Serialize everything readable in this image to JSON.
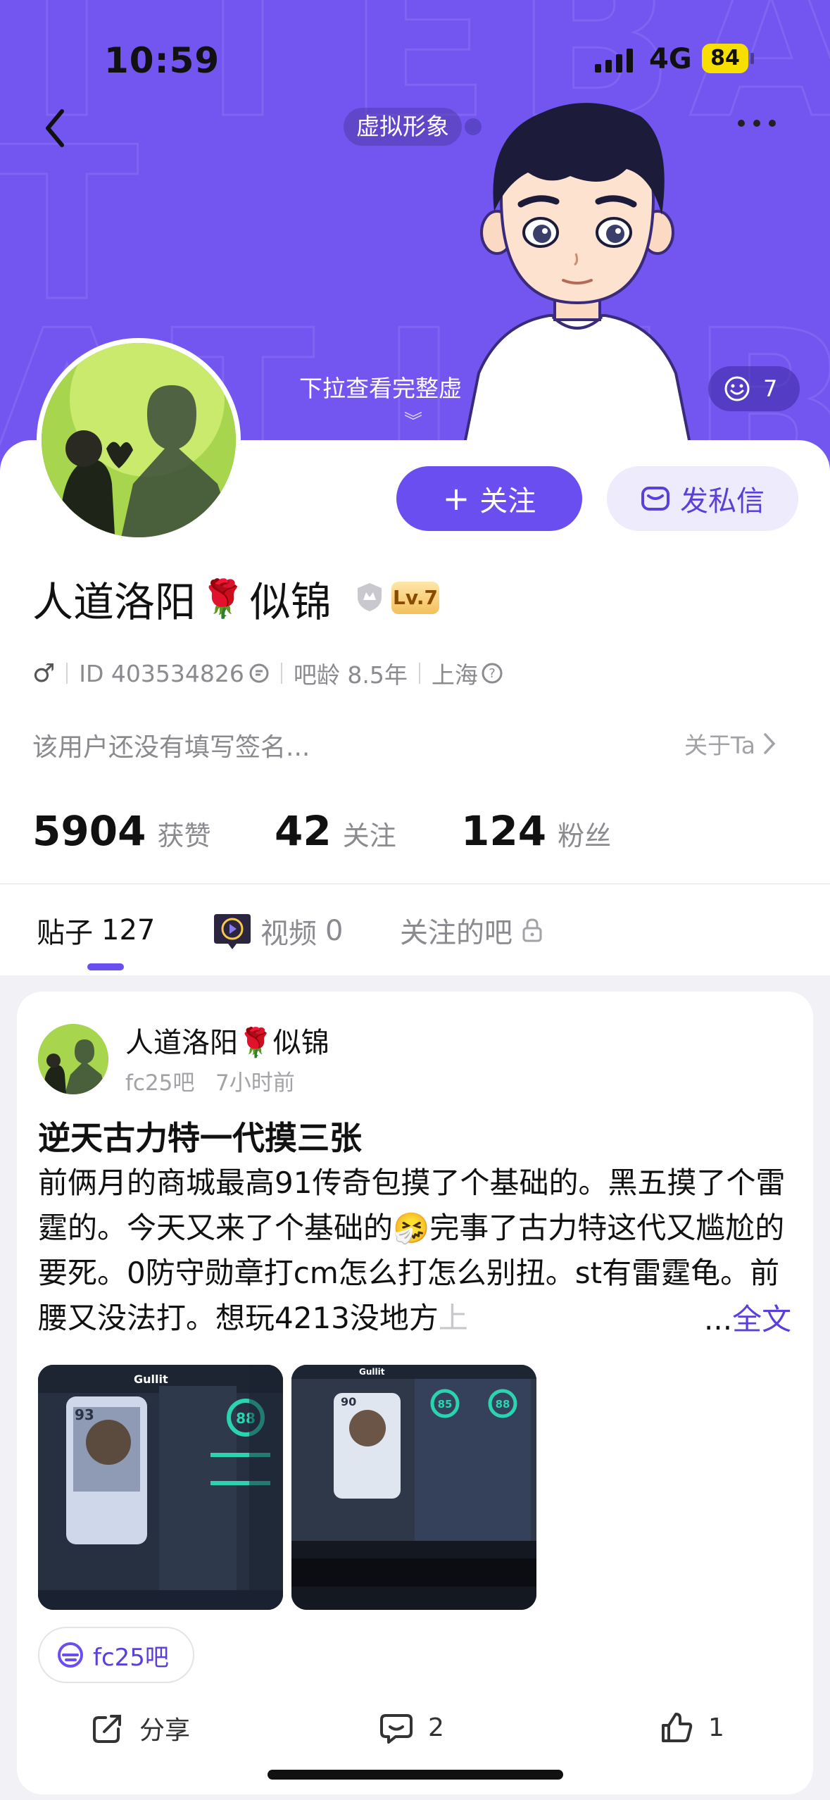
{
  "status_bar": {
    "time": "10:59",
    "network": "4G",
    "battery": "84"
  },
  "header": {
    "avatar_tag": "虚拟形象",
    "pull_hint": "下拉查看完整虚",
    "emoji_count": "7"
  },
  "profile": {
    "name_part1": "人道洛阳",
    "name_rose": "🌹",
    "name_part2": "似锦",
    "level": "Lv.7",
    "follow_label": "关注",
    "dm_label": "发私信",
    "gender": "♂",
    "id_text": "ID 403534826",
    "age_text": "吧龄 8.5年",
    "location": "上海",
    "signature": "该用户还没有填写签名...",
    "about_label": "关于Ta"
  },
  "stats": [
    {
      "value": "5904",
      "label": "获赞"
    },
    {
      "value": "42",
      "label": "关注"
    },
    {
      "value": "124",
      "label": "粉丝"
    }
  ],
  "tabs": {
    "posts_label": "贴子",
    "posts_count": "127",
    "videos_label": "视频",
    "videos_count": "0",
    "followed_label": "关注的吧"
  },
  "post": {
    "author": "人道洛阳🌹似锦",
    "forum": "fc25吧",
    "time": "7小时前",
    "title": "逆天古力特一代摸三张",
    "body": "前俩月的商城最高91传奇包摸了个基础的。黑五摸了个雷霆的。今天又来了个基础的🤧完事了古力特这代又尴尬的要死。0防守勋章打cm怎么打怎么别扭。st有雷霆龟。前腰又没法打。想玩4213没地方",
    "body_fade": "上",
    "more_prefix": "...",
    "more_label": "全文",
    "forum_tag": "fc25吧",
    "share_label": "分享",
    "comments": "2",
    "likes": "1",
    "thumb1": {
      "name": "Gullit",
      "speed": "88",
      "rating": "93"
    },
    "thumb2": {
      "name": "Gullit",
      "speed": "85",
      "shoot": "88",
      "rating": "90"
    }
  }
}
